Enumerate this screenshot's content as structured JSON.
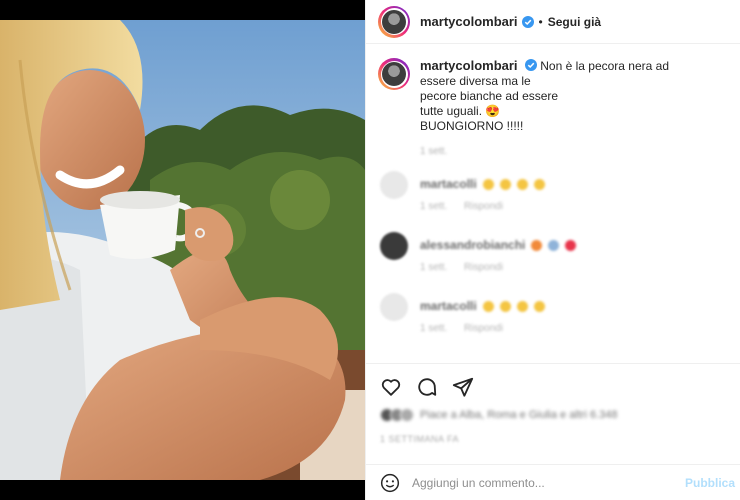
{
  "post": {
    "username": "martycolombari",
    "follow_label": "Segui già",
    "separator": "•",
    "photo_alt": "photo",
    "caption": {
      "line1": "Non è la pecora nera ad",
      "line2": "essere diversa ma le",
      "line3": "pecore bianche ad essere",
      "line4": "tutte uguali.",
      "line5": "BUONGIORNO !!!!!",
      "emoji": "😍",
      "time": "1 sett."
    }
  },
  "comments": [
    {
      "user": "martacolli",
      "meta_time": "1 sett.",
      "meta_reply": "Rispondi",
      "emojis": [
        "yellow",
        "yellow",
        "yellow",
        "yellow"
      ]
    },
    {
      "user": "alessandrobianchi",
      "meta_time": "1 sett.",
      "meta_reply": "Rispondi",
      "emojis": [
        "orange",
        "blue",
        "red"
      ]
    },
    {
      "user": "martacolli",
      "meta_time": "1 sett.",
      "meta_reply": "Rispondi",
      "emojis": [
        "yellow",
        "yellow",
        "yellow",
        "yellow"
      ]
    }
  ],
  "likes": {
    "text": "Piace a Alba, Roma e Giulia e altri 6.348"
  },
  "date": "1 SETTIMANA FA",
  "add_comment": {
    "placeholder": "Aggiungi un commento...",
    "publish_label": "Pubblica"
  },
  "icons": {
    "like": "heart-icon",
    "comment": "comment-icon",
    "share": "share-icon",
    "emoji": "smiley-icon",
    "verified": "verified-badge-icon"
  },
  "colors": {
    "verified": "#3897f0",
    "border": "#efefef",
    "muted": "#8e8e8e"
  }
}
